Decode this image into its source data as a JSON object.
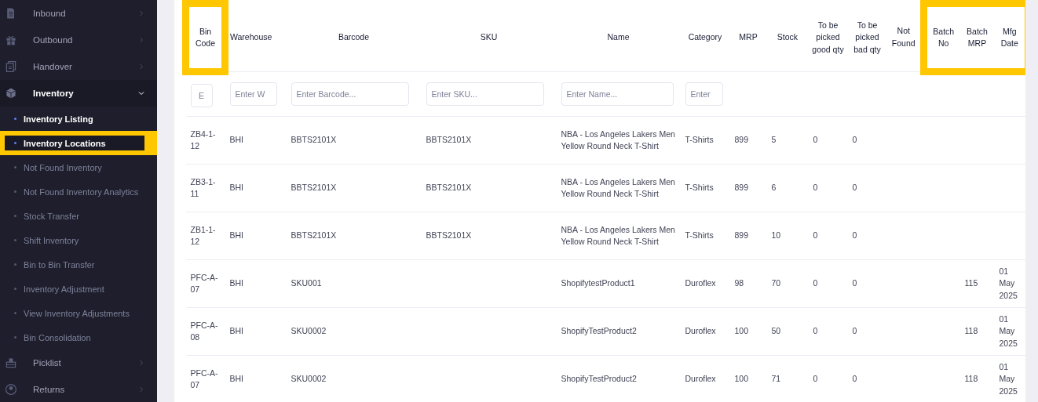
{
  "sidebar": {
    "sections": [
      {
        "label": "Inbound",
        "expanded": false
      },
      {
        "label": "Outbound",
        "expanded": false
      },
      {
        "label": "Handover",
        "expanded": false
      },
      {
        "label": "Inventory",
        "expanded": true,
        "children": [
          {
            "label": "Inventory Listing",
            "selected": true,
            "highlighted": false
          },
          {
            "label": "Inventory Locations",
            "selected": true,
            "highlighted": true
          },
          {
            "label": "Not Found Inventory",
            "selected": false,
            "highlighted": false
          },
          {
            "label": "Not Found Inventory Analytics",
            "selected": false,
            "highlighted": false
          },
          {
            "label": "Stock Transfer",
            "selected": false,
            "highlighted": false
          },
          {
            "label": "Shift Inventory",
            "selected": false,
            "highlighted": false
          },
          {
            "label": "Bin to Bin Transfer",
            "selected": false,
            "highlighted": false
          },
          {
            "label": "Inventory Adjustment",
            "selected": false,
            "highlighted": false
          },
          {
            "label": "View Inventory Adjustments",
            "selected": false,
            "highlighted": false
          },
          {
            "label": "Bin Consolidation",
            "selected": false,
            "highlighted": false
          }
        ]
      },
      {
        "label": "Picklist",
        "expanded": false
      },
      {
        "label": "Returns",
        "expanded": false
      }
    ]
  },
  "table": {
    "columns": [
      {
        "label": "Bin Code",
        "placeholder": "E",
        "highlighted": true
      },
      {
        "label": "Warehouse",
        "placeholder": "Enter W",
        "highlighted": false
      },
      {
        "label": "Barcode",
        "placeholder": "Enter Barcode...",
        "highlighted": false
      },
      {
        "label": "SKU",
        "placeholder": "Enter SKU...",
        "highlighted": false
      },
      {
        "label": "Name",
        "placeholder": "Enter Name...",
        "highlighted": false
      },
      {
        "label": "Category",
        "placeholder": "Enter",
        "highlighted": false
      },
      {
        "label": "MRP",
        "highlighted": false
      },
      {
        "label": "Stock",
        "highlighted": false
      },
      {
        "label": "To be picked good qty",
        "highlighted": false
      },
      {
        "label": "To be picked bad qty",
        "highlighted": false
      },
      {
        "label": "Not Found",
        "highlighted": false
      },
      {
        "label": "Batch No",
        "highlighted": true
      },
      {
        "label": "Batch MRP",
        "highlighted": true
      },
      {
        "label": "Mfg Date",
        "highlighted": true
      }
    ],
    "rows": [
      [
        "ZB4-1-12",
        "BHI",
        "BBTS2101X",
        "BBTS2101X",
        "NBA - Los Angeles Lakers Men Yellow Round Neck T-Shirt",
        "T-Shirts",
        "899",
        "5",
        "0",
        "0",
        null,
        null,
        null,
        null
      ],
      [
        "ZB3-1-11",
        "BHI",
        "BBTS2101X",
        "BBTS2101X",
        "NBA - Los Angeles Lakers Men Yellow Round Neck T-Shirt",
        "T-Shirts",
        "899",
        "6",
        "0",
        "0",
        null,
        null,
        null,
        null
      ],
      [
        "ZB1-1-12",
        "BHI",
        "BBTS2101X",
        "BBTS2101X",
        "NBA - Los Angeles Lakers Men Yellow Round Neck T-Shirt",
        "T-Shirts",
        "899",
        "10",
        "0",
        "0",
        null,
        null,
        null,
        null
      ],
      [
        "PFC-A-07",
        "BHI",
        "SKU001",
        null,
        "ShopifytestProduct1",
        "Duroflex",
        "98",
        "70",
        "0",
        "0",
        null,
        null,
        "115",
        "01 May 2025"
      ],
      [
        "PFC-A-08",
        "BHI",
        "SKU0002",
        null,
        "ShopifyTestProduct2",
        "Duroflex",
        "100",
        "50",
        "0",
        "0",
        null,
        null,
        "118",
        "01 May 2025"
      ],
      [
        "PFC-A-07",
        "BHI",
        "SKU0002",
        null,
        "ShopifyTestProduct2",
        "Duroflex",
        "100",
        "71",
        "0",
        "0",
        null,
        null,
        "118",
        "01 May 2025"
      ]
    ]
  }
}
